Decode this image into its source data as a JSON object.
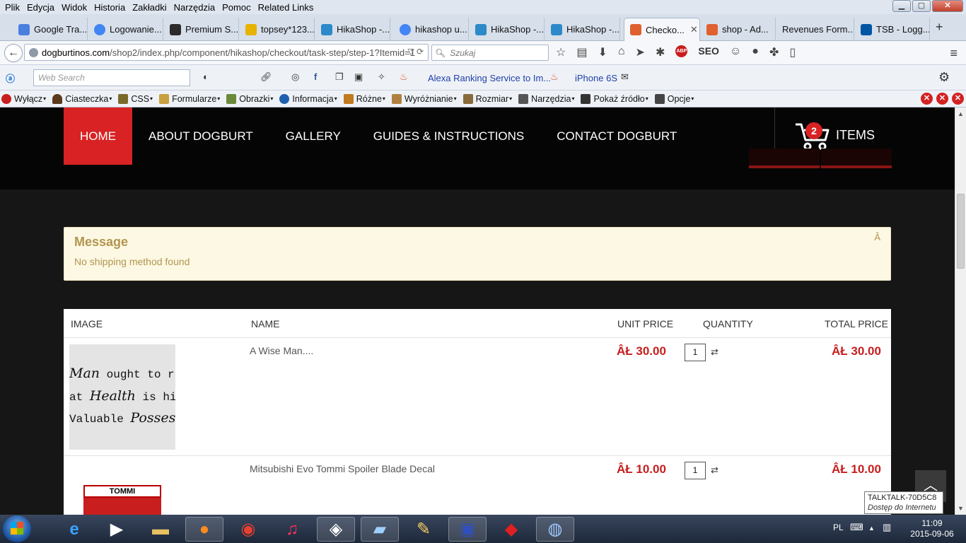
{
  "menu": [
    "Plik",
    "Edycja",
    "Widok",
    "Historia",
    "Zakładki",
    "Narzędzia",
    "Pomoc",
    "Related Links"
  ],
  "window_controls": {
    "minimize": "▁",
    "maximize": "▢",
    "close": "✕"
  },
  "tabs": [
    {
      "label": "Google Tra...",
      "color": "#4a7fe0"
    },
    {
      "label": "Logowanie...",
      "color": "#4285f4"
    },
    {
      "label": "Premium S...",
      "color": "#2b2b2b"
    },
    {
      "label": "topsey*123...",
      "color": "#e8b200"
    },
    {
      "label": "HikaShop -...",
      "color": "#2c8ac8"
    },
    {
      "label": "hikashop u...",
      "color": "#4285f4"
    },
    {
      "label": "HikaShop -...",
      "color": "#2c8ac8"
    },
    {
      "label": "HikaShop -...",
      "color": "#2c8ac8"
    },
    {
      "label": "Checko...",
      "color": "#e06030"
    },
    {
      "label": "shop - Ad...",
      "color": "#e06030"
    },
    {
      "label": "Revenues Form...",
      "color": ""
    },
    {
      "label": "TSB - Logg...",
      "color": "#0055a4"
    }
  ],
  "new_tab": "+",
  "url": {
    "domain": "dogburtinos.com",
    "path": "/shop2/index.php/component/hikashop/checkout/task-step/step-1?Itemid=1"
  },
  "search_placeholder": "Szukaj",
  "toolbar1": {
    "web_search": "Web Search",
    "alexa": "Alexa Ranking Service to Im...",
    "iphone": "iPhone 6S"
  },
  "toolbar2": [
    {
      "label": "Wyłącz",
      "color": "#c81e1e"
    },
    {
      "label": "Ciasteczka",
      "color": "#5a3a1a"
    },
    {
      "label": "CSS",
      "color": "#7a6a2a"
    },
    {
      "label": "Formularze",
      "color": "#c8a040"
    },
    {
      "label": "Obrazki",
      "color": "#6a8a3a"
    },
    {
      "label": "Informacja",
      "color": "#1f5fb0"
    },
    {
      "label": "Różne",
      "color": "#c07a20"
    },
    {
      "label": "Wyróżnianie",
      "color": "#b08040"
    },
    {
      "label": "Rozmiar",
      "color": "#8a6a3a"
    },
    {
      "label": "Narzędzia",
      "color": "#555555"
    },
    {
      "label": "Pokaż źródło",
      "color": "#333333"
    },
    {
      "label": "Opcje",
      "color": "#444444"
    }
  ],
  "site": {
    "nav": [
      {
        "label": "HOME",
        "active": true
      },
      {
        "label": "ABOUT DOGBURT"
      },
      {
        "label": "GALLERY"
      },
      {
        "label": "GUIDES & INSTRUCTIONS"
      },
      {
        "label": "CONTACT DOGBURT"
      }
    ],
    "cart": {
      "count": "2",
      "label": "ITEMS"
    },
    "message": {
      "title": "Message",
      "text": "No shipping method found",
      "close": "Â"
    },
    "table": {
      "headers": {
        "image": "IMAGE",
        "name": "NAME",
        "unit_price": "UNIT PRICE",
        "quantity": "QUANTITY",
        "total_price": "TOTAL PRICE"
      },
      "rows": [
        {
          "name": "A Wise Man....",
          "unit_price": "ÂŁ 30.00",
          "qty": "1",
          "total": "ÂŁ 30.00"
        },
        {
          "name": "Mitsubishi Evo Tommi Spoiler Blade Decal",
          "unit_price": "ÂŁ 10.00",
          "qty": "1",
          "total": "ÂŁ 10.00"
        }
      ],
      "img1_lines": [
        {
          "a": "Man",
          "b": " ought to r"
        },
        {
          "a": "at ",
          "b": "Health",
          "c": " is hi"
        },
        {
          "a": "Valuable ",
          "b": "Possess"
        }
      ],
      "img2_text": "TOMMI"
    }
  },
  "tooltip": {
    "line1": "TALKTALK-70D5C8",
    "line2": "Dostęp do Internetu"
  },
  "tray": {
    "lang": "PL",
    "time": "11:09",
    "date": "2015-09-06"
  }
}
